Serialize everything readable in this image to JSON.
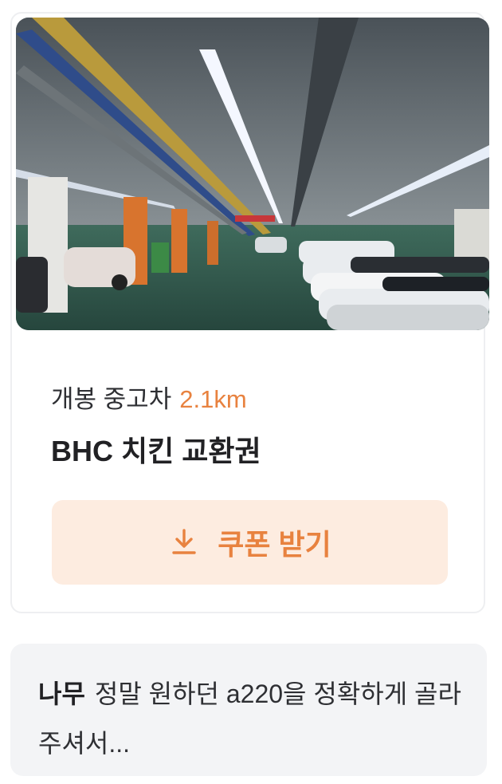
{
  "post": {
    "image_alt": "indoor used car parking garage",
    "location": "개봉 중고차",
    "distance": "2.1km",
    "title": "BHC 치킨 교환권",
    "coupon_button_label": "쿠폰 받기",
    "coupon_icon": "download-icon"
  },
  "review": {
    "author": "나무",
    "text": "정말 원하던 a220을 정확하게 골라주셔서..."
  },
  "colors": {
    "accent": "#e8823f",
    "button_bg": "#fdece0",
    "review_bg": "#f3f4f6",
    "text_primary": "#212124"
  }
}
